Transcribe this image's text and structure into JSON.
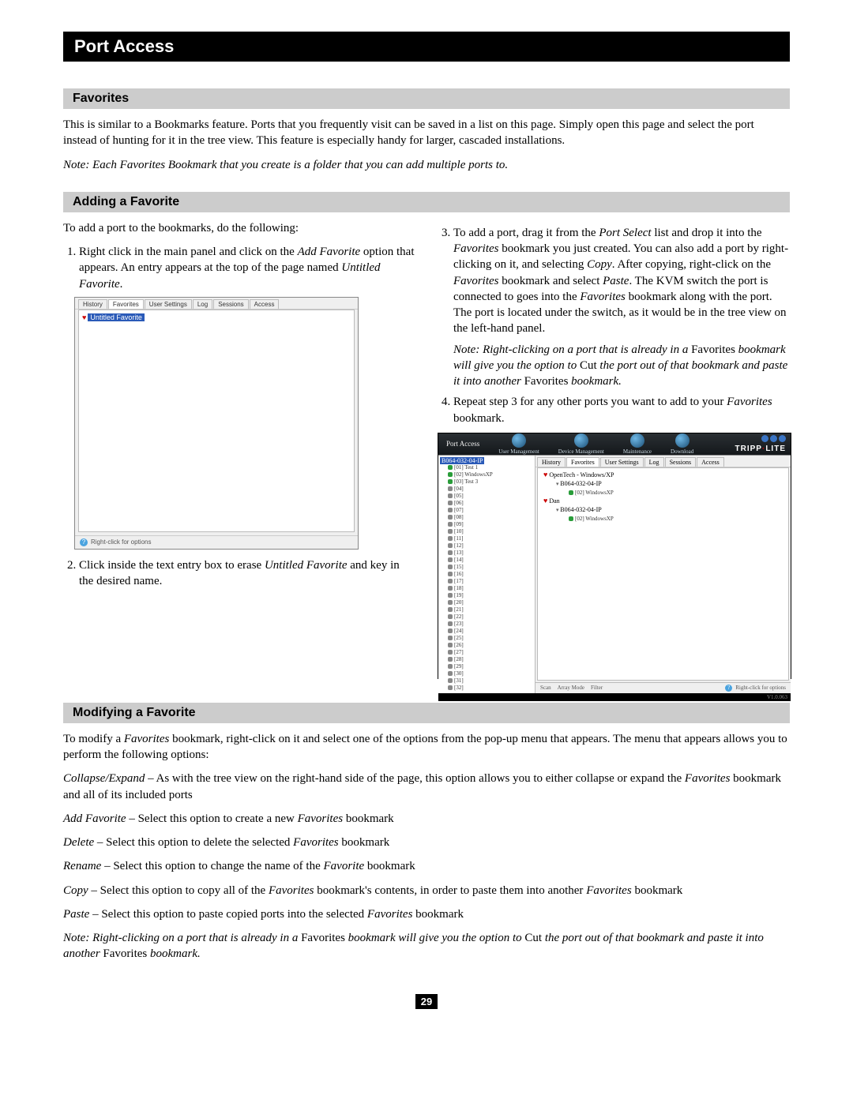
{
  "header": {
    "title": "Port Access"
  },
  "favorites": {
    "heading": "Favorites",
    "intro": "This is similar to a Bookmarks feature. Ports that you frequently visit can be saved in a list on this page. Simply open this page and select the port instead of hunting for it in the tree view. This feature is especially handy for larger, cascaded installations.",
    "note_prefix": "Note: ",
    "note_body_1": "Each ",
    "note_term": "Favorites Bookmark",
    "note_body_2": " that you create is a folder that you can add multiple ports to."
  },
  "adding": {
    "heading": "Adding a Favorite",
    "intro": "To add a port to the bookmarks, do the following:",
    "step1_a": "Right click in the main panel and click on the ",
    "step1_term": "Add Favorite",
    "step1_b": " option that appears. An entry appears at the top of the page named ",
    "step1_c": "Untitled Favorite",
    "step1_d": ".",
    "step2_a": "Click inside the text entry box to erase ",
    "step2_term": "Untitled Favorite",
    "step2_b": " and key in the desired name.",
    "step3": "To add a port, drag it from the Port Select list and drop it into the Favorites bookmark you just created. You can also add a port by right-clicking on it, and selecting Copy. After copying, right-click on the Favorites bookmark and select Paste. The KVM switch the port is connected to goes into the Favorites bookmark along with the port. The port is located under the switch, as it would be in the tree view on the left-hand panel.",
    "step3_note": "Note: Right-clicking on a port that is already in a Favorites bookmark will give you the option to Cut the port out of that bookmark and paste it into another Favorites bookmark.",
    "step4_a": "Repeat step 3 for any other ports you want to add to your ",
    "step4_term": "Favorites",
    "step4_b": " bookmark."
  },
  "ss": {
    "tabs": [
      "History",
      "Favorites",
      "User Settings",
      "Log",
      "Sessions",
      "Access"
    ],
    "untitled": "Untitled Favorite",
    "footer_hint": "Right-click for options",
    "brand": "TRIPP",
    "brand2": "LITE",
    "top_label": "Port Access",
    "nav": [
      "User Management",
      "Device Management",
      "Maintenance",
      "Download"
    ],
    "root": "B064-032-04-IP",
    "ports_named": [
      "[01] Test 1",
      "[02] WindowsXP",
      "[03] Test 3"
    ],
    "port_bare_prefix": "[",
    "port_bare_suffix": "]",
    "fav1": "OpenTech - Windows/XP",
    "fav1_dev": "B064-032-04-IP",
    "fav1_port": "[02] WindowsXP",
    "fav2": "Dan",
    "fav2_dev": "B064-032-04-IP",
    "fav2_port": "[02] WindowsXP",
    "status_scan": "Scan",
    "status_array": "Array Mode",
    "status_filter": "Filter",
    "version": "V1.0.063"
  },
  "modifying": {
    "heading": "Modifying a Favorite",
    "intro": "To modify a Favorites bookmark, right-click on it and select one of the options from the pop-up menu that appears. The menu that appears allows you to perform the following options:",
    "opt1_term": "Collapse/Expand",
    "opt1_body": " – As with the tree view on the right-hand side of the page, this option allows you to either collapse or expand the Favorites bookmark and all of its included ports",
    "opt2_term": "Add Favorite",
    "opt2_body": " – Select this option to create a new Favorites bookmark",
    "opt3_term": "Delete",
    "opt3_body": " – Select this option to delete the selected Favorites bookmark",
    "opt4_term": "Rename",
    "opt4_body": " – Select this option to change the name of the Favorite bookmark",
    "opt5_term": "Copy",
    "opt5_body": " – Select this option to copy all of the Favorites bookmark's contents, in order to paste them into another Favorites bookmark",
    "opt6_term": "Paste",
    "opt6_body": " – Select this option to paste copied ports into the selected Favorites bookmark",
    "end_note": "Note: Right-clicking on a port that is already in a Favorites bookmark will give you the option to Cut the port out of that bookmark and paste it into another Favorites bookmark."
  },
  "page_number": "29"
}
